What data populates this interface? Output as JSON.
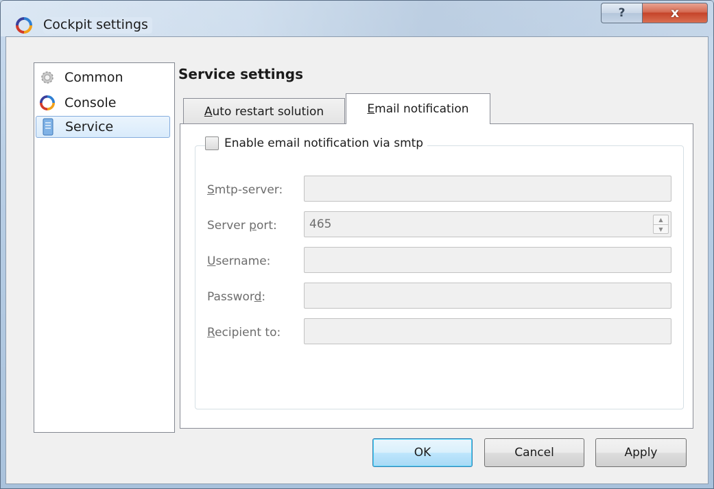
{
  "window": {
    "title": "Cockpit settings",
    "help_label": "?",
    "close_label": "x"
  },
  "nav": {
    "items": [
      {
        "label": "Common",
        "icon": "gear-icon",
        "selected": false
      },
      {
        "label": "Console",
        "icon": "cockpit-logo-icon",
        "selected": false
      },
      {
        "label": "Service",
        "icon": "server-icon",
        "selected": true
      }
    ]
  },
  "main": {
    "title": "Service settings",
    "tabs": [
      {
        "label_prefix": "",
        "label_mnemonic": "A",
        "label_rest": "uto restart solution",
        "active": false
      },
      {
        "label_prefix": "",
        "label_mnemonic": "E",
        "label_rest": "mail notification",
        "active": true
      }
    ],
    "group": {
      "checkbox_label": "Enable email notification via smtp",
      "checked": false
    },
    "fields": [
      {
        "label_prefix": "",
        "mnemonic": "S",
        "label_rest": "mtp-server:",
        "value": "",
        "type": "text"
      },
      {
        "label_prefix": "Server ",
        "mnemonic": "p",
        "label_rest": "ort:",
        "value": "465",
        "type": "spin"
      },
      {
        "label_prefix": "",
        "mnemonic": "U",
        "label_rest": "sername:",
        "value": "",
        "type": "text"
      },
      {
        "label_prefix": "Passwor",
        "mnemonic": "d",
        "label_rest": ":",
        "value": "",
        "type": "password"
      },
      {
        "label_prefix": "",
        "mnemonic": "R",
        "label_rest": "ecipient to:",
        "value": "",
        "type": "text"
      }
    ]
  },
  "buttons": {
    "ok": "OK",
    "cancel": "Cancel",
    "apply": "Apply"
  }
}
